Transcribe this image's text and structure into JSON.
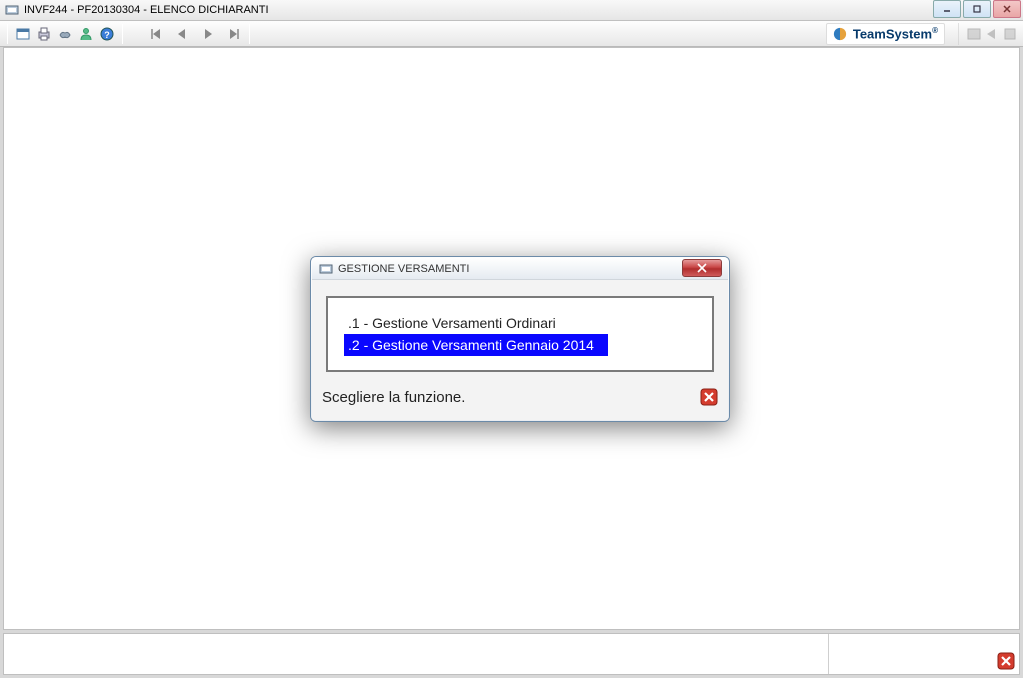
{
  "window": {
    "title": "INVF244  - PF20130304 -  ELENCO DICHIARANTI"
  },
  "brand": {
    "text": "TeamSystem"
  },
  "dialog": {
    "title": "GESTIONE VERSAMENTI",
    "options": [
      {
        "label": ".1 - Gestione Versamenti Ordinari",
        "selected": false
      },
      {
        "label": ".2 - Gestione Versamenti Gennaio 2014",
        "selected": true
      }
    ],
    "footer_text": "Scegliere la funzione."
  }
}
